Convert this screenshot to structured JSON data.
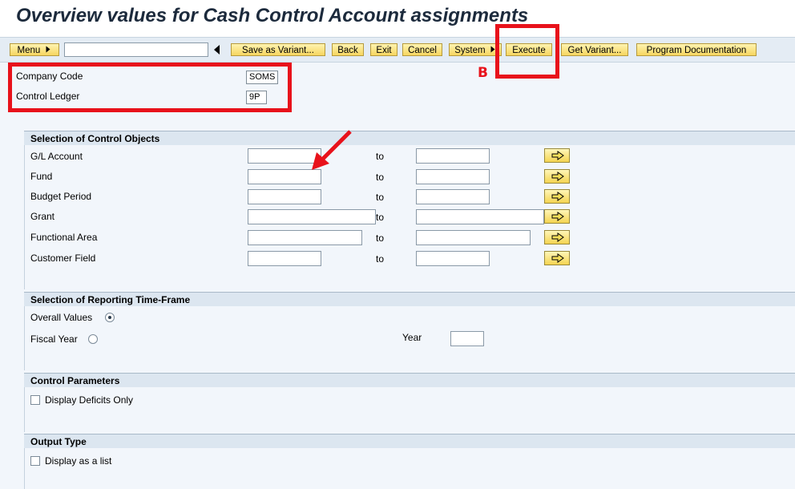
{
  "title": "Overview values for Cash Control Account assignments",
  "toolbar": {
    "menu_label": "Menu",
    "save_variant": "Save as Variant...",
    "back": "Back",
    "exit": "Exit",
    "cancel": "Cancel",
    "system": "System",
    "execute": "Execute",
    "get_variant": "Get Variant...",
    "program_documentation": "Program Documentation"
  },
  "annotation_letter": "B",
  "header_fields": {
    "company_code_label": "Company Code",
    "company_code_value": "SOMS",
    "control_ledger_label": "Control Ledger",
    "control_ledger_value": "9P"
  },
  "control_objects": {
    "title": "Selection of Control Objects",
    "to_label": "to",
    "rows": [
      {
        "label": "G/L Account"
      },
      {
        "label": "Fund"
      },
      {
        "label": "Budget Period"
      },
      {
        "label": "Grant"
      },
      {
        "label": "Functional Area"
      },
      {
        "label": "Customer Field"
      }
    ]
  },
  "time_frame": {
    "title": "Selection of  Reporting Time-Frame",
    "overall_values": "Overall Values",
    "overall_selected": true,
    "fiscal_year": "Fiscal Year",
    "year_label": "Year",
    "year_value": ""
  },
  "control_parameters": {
    "title": "Control Parameters",
    "display_deficits_only": "Display Deficits Only",
    "checked": false
  },
  "output_type": {
    "title": "Output Type",
    "display_as_list": "Display as a list",
    "checked": false
  },
  "colors": {
    "annotation_red": "#e8121b",
    "button_yellow": "#f6d660",
    "section_header": "#dce6f0"
  }
}
